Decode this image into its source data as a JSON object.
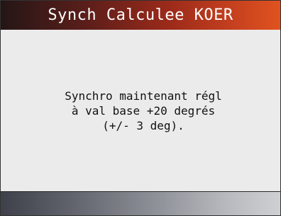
{
  "screen": {
    "title": "Synch Calculee KOER",
    "message_lines": [
      "Synchro maintenant régl",
      "à val base +20 degrés",
      "(+/- 3 deg)."
    ]
  },
  "colors": {
    "title_bar_gradient": [
      "#241616",
      "#9b2a1a",
      "#e0531f"
    ],
    "title_text": "#ffffff",
    "content_background": "#ebebeb",
    "footer_gradient": [
      "#3e4149",
      "#8d9097",
      "#cfd0d3"
    ]
  }
}
